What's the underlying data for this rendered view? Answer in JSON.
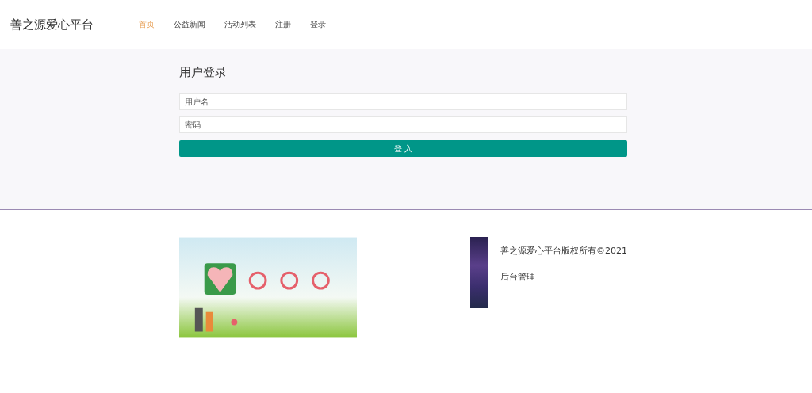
{
  "brand": "善之源爱心平台",
  "nav": [
    {
      "label": "首页",
      "selected": true
    },
    {
      "label": "公益新闻",
      "selected": false
    },
    {
      "label": "活动列表",
      "selected": false
    },
    {
      "label": "注册",
      "selected": false
    },
    {
      "label": "登录",
      "selected": false
    }
  ],
  "login": {
    "title": "用户登录",
    "fields": [
      {
        "placeholder": "用户名"
      },
      {
        "placeholder": "密码"
      }
    ],
    "submit": "登 入"
  },
  "footer": {
    "copyright": "善之源爱心平台版权所有©2021",
    "admin_link": "后台管理"
  }
}
